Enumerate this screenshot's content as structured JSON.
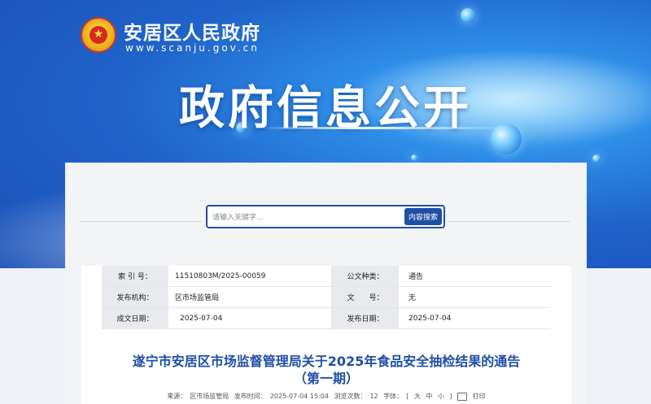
{
  "site": {
    "name": "安居区人民政府",
    "url": "www.scanju.gov.cn",
    "banner_title": "政府信息公开"
  },
  "search": {
    "placeholder": "请输入关键字...",
    "button": "内容搜索"
  },
  "meta": {
    "rows": [
      {
        "label1": "索 引 号：",
        "value1": "11510803M/2025-00059",
        "label2": "公文种类：",
        "value2": "通告"
      },
      {
        "label1": "发布机构：",
        "value1": "区市场监管局",
        "label2": "文　　号：",
        "value2": "无"
      },
      {
        "label1": "成文日期：",
        "value1": "2025-07-04",
        "label2": "发布日期：",
        "value2": "2025-07-04"
      }
    ]
  },
  "article": {
    "title_line1": "遂宁市安居区市场监督管理局关于2025年食品安全抽检结果的通告",
    "title_line2": "（第一期）",
    "source_label": "来源：",
    "source": "区市场监管局",
    "time_label": "发布时间：",
    "time": "2025-07-04 15:04",
    "views_label": "浏览次数：",
    "views": "12",
    "font_label": "字体：",
    "font_open": "[",
    "font_big": "大",
    "font_mid": "中",
    "font_small": "小",
    "font_close": "]",
    "print": "打印"
  },
  "colors": {
    "accent": "#1f4ea6",
    "banner_blue": "#1f62c9"
  }
}
